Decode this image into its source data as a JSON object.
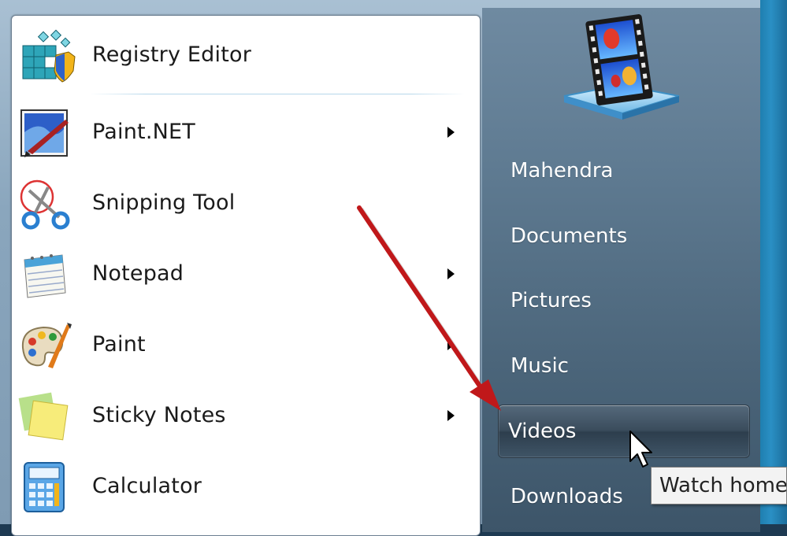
{
  "start_menu": {
    "programs": [
      {
        "label": "Registry Editor",
        "icon": "registry-editor-icon",
        "has_submenu": false
      },
      {
        "label": "Paint.NET",
        "icon": "paint-net-icon",
        "has_submenu": true
      },
      {
        "label": "Snipping Tool",
        "icon": "snipping-tool-icon",
        "has_submenu": false
      },
      {
        "label": "Notepad",
        "icon": "notepad-icon",
        "has_submenu": true
      },
      {
        "label": "Paint",
        "icon": "paint-icon",
        "has_submenu": true
      },
      {
        "label": "Sticky Notes",
        "icon": "sticky-notes-icon",
        "has_submenu": true
      },
      {
        "label": "Calculator",
        "icon": "calculator-icon",
        "has_submenu": false
      }
    ],
    "places": [
      {
        "label": "Mahendra"
      },
      {
        "label": "Documents"
      },
      {
        "label": "Pictures"
      },
      {
        "label": "Music"
      },
      {
        "label": "Videos",
        "hovered": true
      },
      {
        "label": "Downloads"
      }
    ],
    "tooltip": "Watch home",
    "user_picture_icon": "videos-filmstrip-icon"
  },
  "colors": {
    "right_pane": "#5f7b92",
    "hover_highlight": "#3a4c5c",
    "annotation_arrow": "#c0181a",
    "taskbar_strip": "#2a8fc4"
  }
}
